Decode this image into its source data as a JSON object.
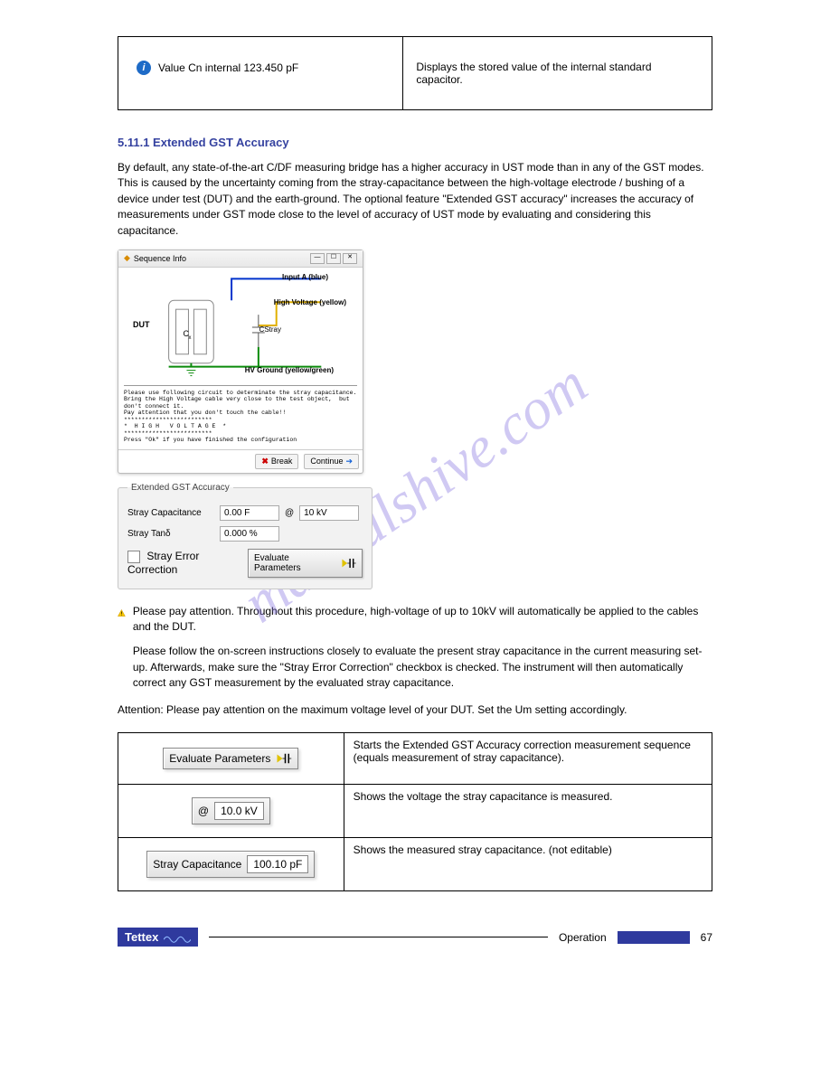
{
  "watermark": "manualshive.com",
  "info_badge_text": "Value Cn internal  123.450 pF",
  "info_badge_desc": "Displays the stored value of the internal standard capacitor.",
  "section_title": "5.11.1     Extended GST Accuracy",
  "section_intro": "By default, any state-of-the-art C/DF measuring bridge has a higher accuracy in UST mode than in any of the GST modes. This is caused by the uncertainty coming from the stray-capacitance between the high-voltage electrode / bushing of a device under test (DUT) and the earth-ground. The optional feature \"Extended GST accuracy\" increases the accuracy of measurements under GST mode close to the level of accuracy of UST mode by evaluating and considering this capacitance.",
  "seq_window": {
    "title": "Sequence Info",
    "input_label": "Input A (blue)",
    "hv_label": "High Voltage (yellow)",
    "dut_label": "DUT",
    "cx_label": "Cx",
    "cstray_label": "CStray",
    "gnd_label": "HV Ground (yellow/green)",
    "text": "Please use following circuit to determinate the stray capacitance.\nBring the High Voltage cable very close to the test object,  but don't connect it.\nPay attention that you don't touch the cable!!\n*************************\n*  H I G H   V O L T A G E  *\n*************************\nPress \"Ok\" if you have finished the configuration",
    "break_btn": "Break",
    "continue_btn": "Continue"
  },
  "gst_panel": {
    "legend": "Extended GST Accuracy",
    "stray_cap_label": "Stray Capacitance",
    "stray_cap_value": "0.00 F",
    "at_label": "@",
    "at_value": "10 kV",
    "stray_tan_label": "Stray Tanδ",
    "stray_tan_value": "0.000 %",
    "check_label": "Stray Error Correction",
    "eval_btn": "Evaluate Parameters"
  },
  "warn_block": {
    "p1": "Please pay attention. Throughout this procedure, high-voltage of up to 10kV will automatically be applied to the cables and the DUT.",
    "p2": "Please follow the on-screen instructions closely to evaluate the present stray capacitance in the current measuring set-up. Afterwards, make sure the \"Stray Error Correction\" checkbox is checked. The instrument will then automatically correct any GST measurement by the evaluated stray capacitance."
  },
  "attention_line": "Attention: Please pay attention on the maximum voltage level of your DUT. Set the Um setting accordingly.",
  "table2": {
    "row1_btn": "Evaluate Parameters",
    "row1_desc": "Starts the Extended GST Accuracy correction measurement sequence (equals measurement of stray capacitance).",
    "row2_at": "@",
    "row2_field": "10.0 kV",
    "row2_desc": "Shows the voltage the stray capacitance is measured.",
    "row3_label": "Stray Capacitance",
    "row3_field": "100.10 pF",
    "row3_desc": "Shows the measured stray capacitance. (not editable)"
  },
  "footer": {
    "brand": "Tettex",
    "section": "Operation",
    "page": "67"
  }
}
